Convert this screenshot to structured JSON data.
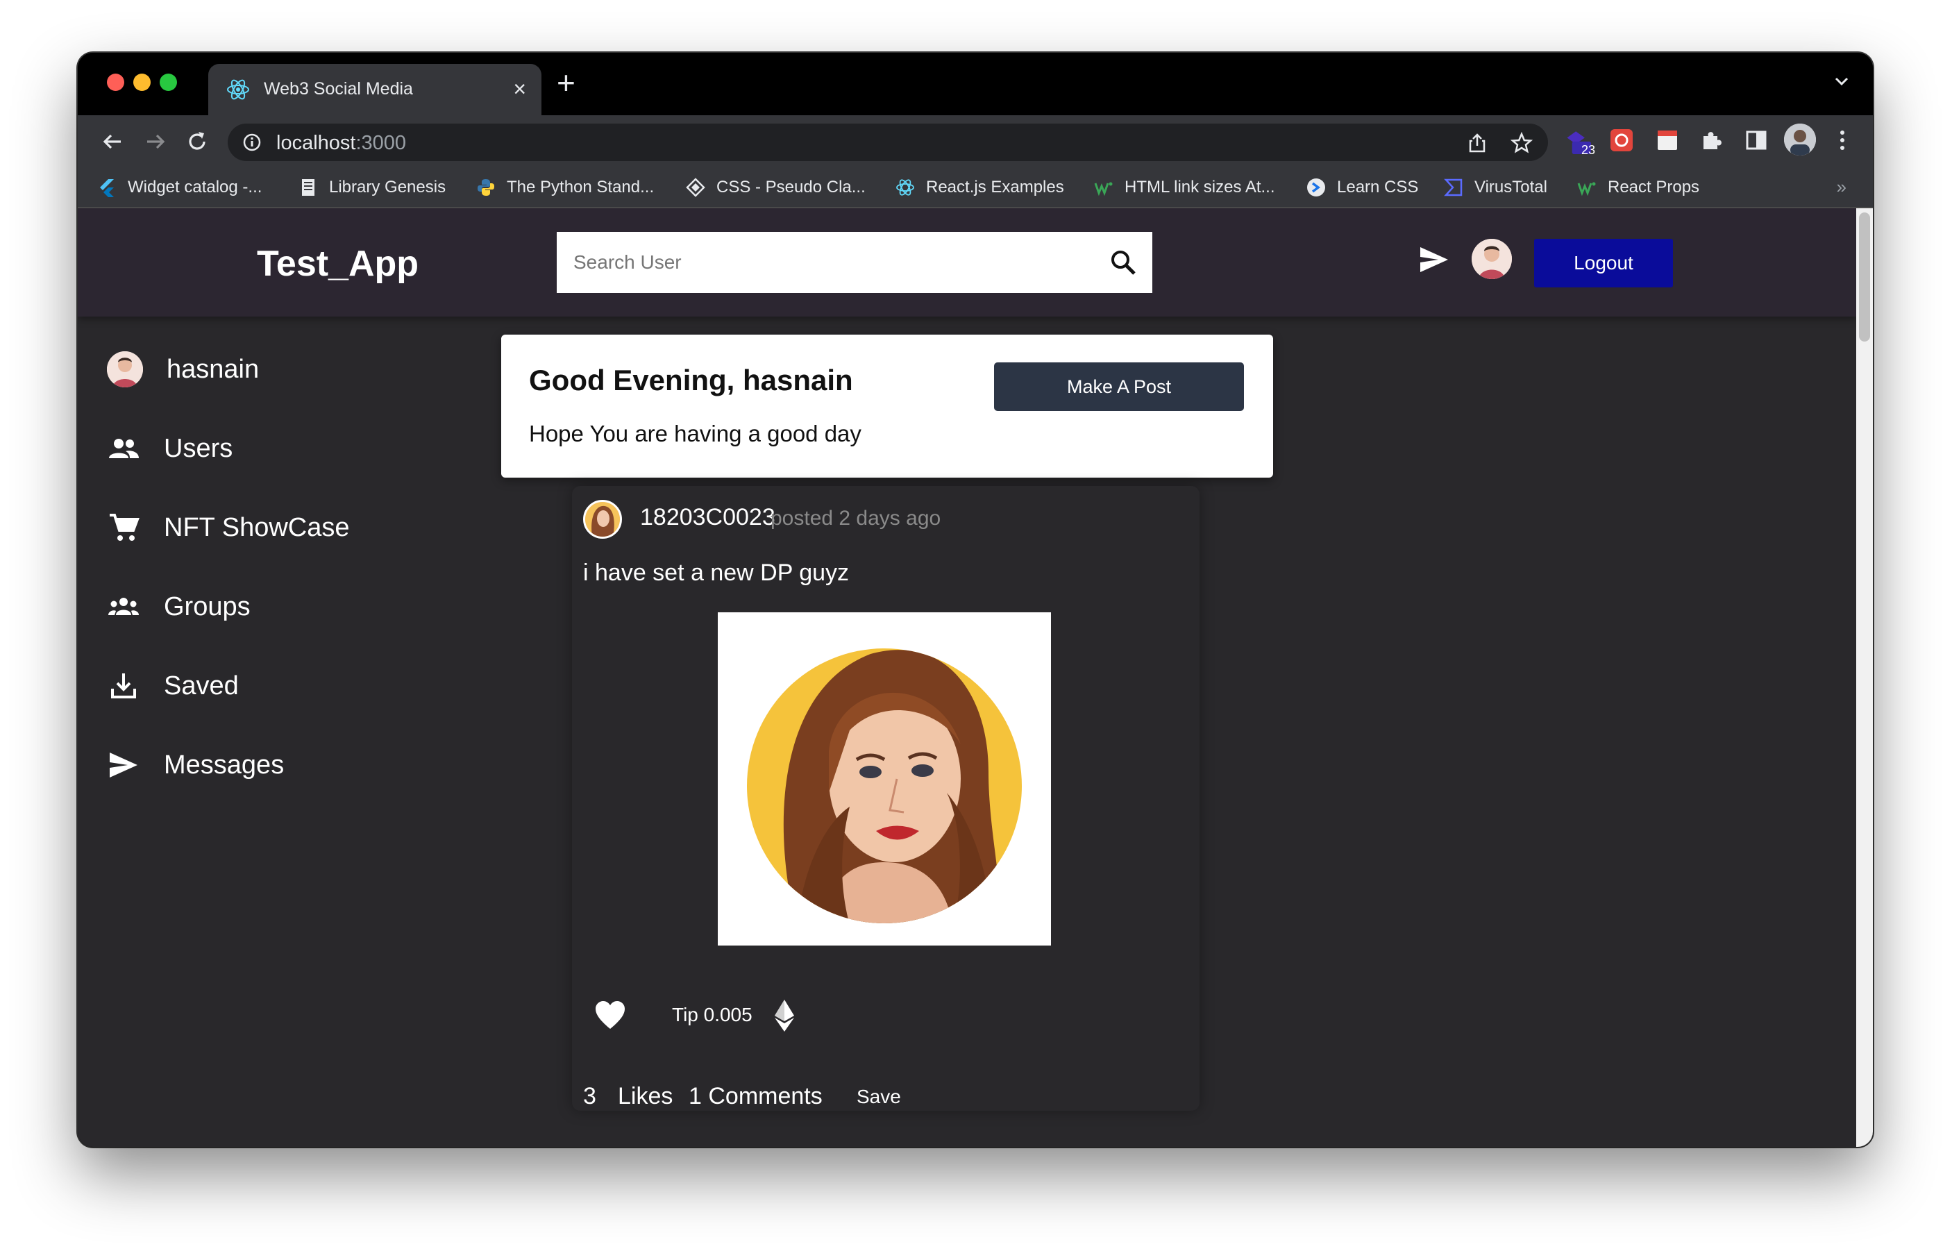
{
  "browser": {
    "tab_title": "Web3 Social Media",
    "tab_close": "×",
    "new_tab": "+",
    "url_host": "localhost",
    "url_port": ":3000",
    "extension_badge": "23",
    "bookmarks": [
      {
        "label": "Widget catalog -...",
        "icon": "flutter-icon"
      },
      {
        "label": "Library Genesis",
        "icon": "book-icon"
      },
      {
        "label": "The Python Stand...",
        "icon": "python-icon"
      },
      {
        "label": "CSS - Pseudo Cla...",
        "icon": "css-icon"
      },
      {
        "label": "React.js Examples",
        "icon": "react-icon"
      },
      {
        "label": "HTML link sizes At...",
        "icon": "w-icon"
      },
      {
        "label": "Learn CSS",
        "icon": "learn-icon"
      },
      {
        "label": "VirusTotal",
        "icon": "virustotal-icon"
      },
      {
        "label": "React Props",
        "icon": "w-icon"
      }
    ],
    "bookmarks_more": "»"
  },
  "app": {
    "brand": "Test_App",
    "search_placeholder": "Search User",
    "logout_label": "Logout"
  },
  "sidebar": {
    "items": [
      {
        "label": "hasnain",
        "icon": "user-avatar"
      },
      {
        "label": "Users",
        "icon": "users-icon"
      },
      {
        "label": "NFT ShowCase",
        "icon": "cart-icon"
      },
      {
        "label": "Groups",
        "icon": "groups-icon"
      },
      {
        "label": "Saved",
        "icon": "download-icon"
      },
      {
        "label": "Messages",
        "icon": "send-icon"
      }
    ]
  },
  "greeting": {
    "title": "Good Evening, hasnain",
    "subtitle": "Hope You are having a good day",
    "make_post_label": "Make A Post"
  },
  "post": {
    "author": "18203C0023",
    "time": "posted 2 days ago",
    "text": "i have set a new DP guyz",
    "tip": "Tip 0.005",
    "likes_count": "3",
    "likes_label": "Likes",
    "comments": "1 Comments",
    "save_label": "Save"
  },
  "colors": {
    "page_bg": "#29282b",
    "appbar_bg": "#2c2631",
    "logout_bg": "#0a0c9a",
    "make_post_bg": "#2c3545"
  }
}
